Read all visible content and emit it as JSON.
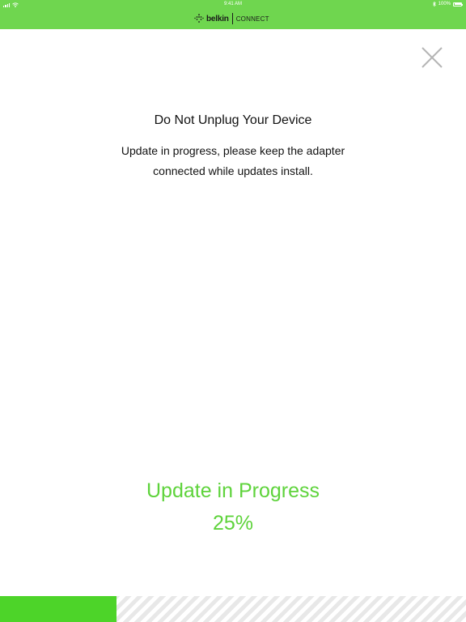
{
  "status_bar": {
    "time": "9:41 AM",
    "battery_text": "100%",
    "battery_level": 1.0,
    "icons": [
      "signal-icon",
      "wifi-icon",
      "bluetooth-icon",
      "battery-icon"
    ]
  },
  "header": {
    "brand": "belkin",
    "product": "CONNECT",
    "logo_icon": "belkin-logo-icon",
    "background_color": "#6fd64f"
  },
  "close_button": {
    "icon": "close-icon"
  },
  "dialog": {
    "title": "Do Not Unplug Your Device",
    "message_line1": "Update in progress, please keep the adapter",
    "message_line2": "connected while updates install."
  },
  "progress": {
    "label": "Update in Progress",
    "percent_text": "25%",
    "value": 0.25,
    "color": "#5ed33b",
    "bar_color": "#4dd429"
  }
}
